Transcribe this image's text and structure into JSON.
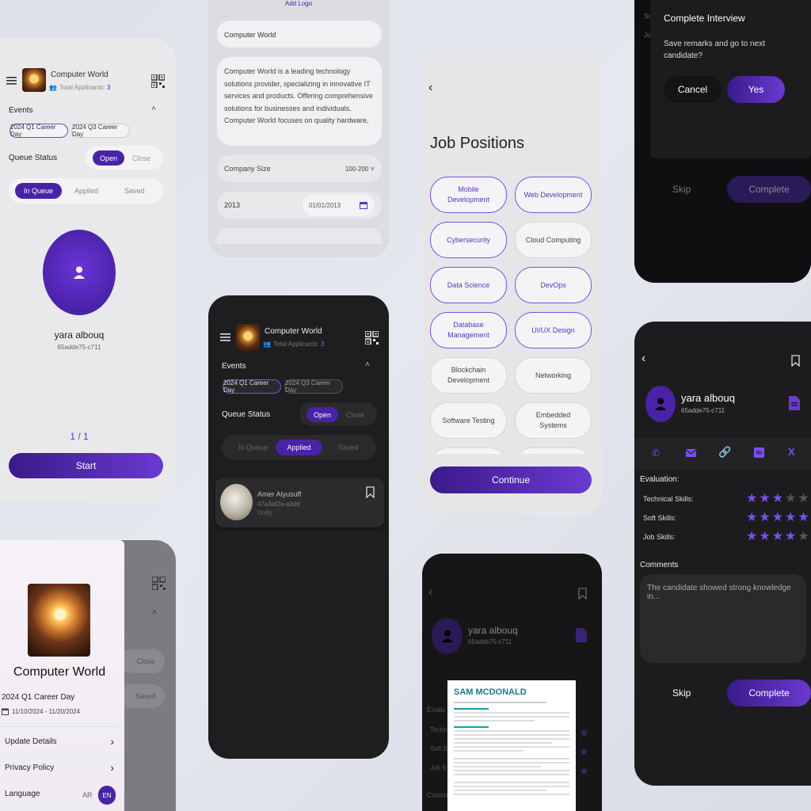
{
  "colors": {
    "accent": "#4a22a8",
    "star": "#7b4ff0",
    "bg": "#e3e5ec"
  },
  "p1": {
    "company": "Computer World",
    "applicants": "Total Applicants:",
    "applicants_count": "3",
    "events_label": "Events",
    "event_chips": [
      "2024 Q1 Career Day",
      "2024 Q3 Career Day"
    ],
    "queue_status": "Queue Status",
    "open": "Open",
    "close": "Close",
    "tabs": [
      "In Queue",
      "Applied",
      "Saved"
    ],
    "candidate_name": "yara albouq",
    "candidate_id": "65adde75-c711",
    "pager": "1 / 1",
    "start": "Start"
  },
  "p2": {
    "add_logo": "Add Logo",
    "company_name": "Computer World",
    "description": "Computer World is a leading technology solutions provider, specializing in innovative IT services and products. Offering comprehensive solutions for businesses and individuals, Computer World focuses on quality hardware,",
    "company_size_label": "Company Size",
    "company_size_value": "100-200",
    "year": "2013",
    "date": "01/01/2013"
  },
  "p3": {
    "title": "Job Positions",
    "positions": [
      "Mobile Development",
      "Web Development",
      "Cybersecurity",
      "Cloud Computing",
      "Data Science",
      "DevOps",
      "Database Management",
      "UI/UX Design",
      "Blockchain Development",
      "Networking",
      "Software Testing",
      "Embedded Systems"
    ],
    "continue": "Continue"
  },
  "p4": {
    "title": "Complete Interview",
    "message": "Save remarks and go to next candidate?",
    "cancel": "Cancel",
    "yes": "Yes",
    "skip": "Skip",
    "complete": "Complete"
  },
  "p5": {
    "company": "Computer World",
    "applicants": "Total Applicants:",
    "applicants_count": "3",
    "events_label": "Events",
    "event_chips": [
      "2024 Q1 Career Day",
      "2024 Q3 Career Day"
    ],
    "queue_status": "Queue Status",
    "open": "Open",
    "close": "Close",
    "tabs": [
      "In Queue",
      "Applied",
      "Saved"
    ],
    "applicant_name": "Amer Alyusuff",
    "applicant_id": "47a3af2a-a3dd",
    "applicant_org": "Unity"
  },
  "p6": {
    "name": "yara albouq",
    "id": "65adde75-c711",
    "evaluation": "Evaluation:",
    "skills": [
      {
        "label": "Technical Skills:",
        "rating": 3
      },
      {
        "label": "Soft Skills:",
        "rating": 5
      },
      {
        "label": "Job Skills:",
        "rating": 4
      }
    ],
    "comments_label": "Comments",
    "comment": "The candidate showed strong knowledge in...",
    "skip": "Skip",
    "complete": "Complete"
  },
  "p7": {
    "company": "Computer World",
    "event": "2024 Q1 Career Day",
    "dates": "11/10/2024 - 11/20/2024",
    "menu": [
      "Update Details",
      "Privacy Policy",
      "Language"
    ],
    "lang_ar": "AR",
    "lang_en": "EN",
    "bg_close": "Close",
    "bg_saved": "Saved"
  },
  "p8": {
    "name": "yara albouq",
    "id": "65adde75-c711",
    "bg_labels": [
      "Evalu",
      "Techn",
      "Soft S",
      "Job S",
      "Comm"
    ],
    "resume_name": "SAM MCDONALD"
  }
}
